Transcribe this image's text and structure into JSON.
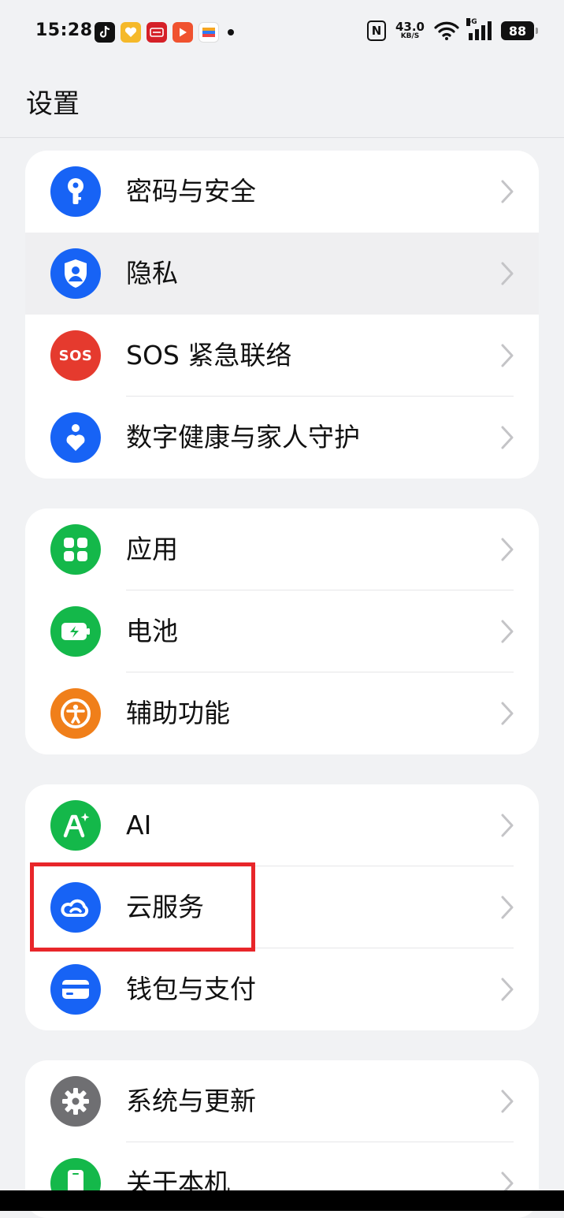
{
  "status": {
    "time": "15:28",
    "speed_value": "43.0",
    "speed_unit": "KB/S",
    "network": "5G",
    "battery": "88",
    "nfc": "N"
  },
  "notifications": [
    "tiktok-icon",
    "heart-app-icon",
    "news-app-icon",
    "video-app-icon",
    "wallet-app-icon"
  ],
  "page_title": "设置",
  "groups": [
    {
      "items": [
        {
          "label": "密码与安全",
          "icon": "key-icon",
          "color": "#1763f5"
        },
        {
          "label": "隐私",
          "icon": "shield-user-icon",
          "color": "#1763f5",
          "highlighted": true
        },
        {
          "label": "SOS 紧急联络",
          "icon": "sos-icon",
          "color": "#e53a2e",
          "icon_text": "SOS"
        },
        {
          "label": "数字健康与家人守护",
          "icon": "person-heart-icon",
          "color": "#1763f5"
        }
      ]
    },
    {
      "items": [
        {
          "label": "应用",
          "icon": "apps-grid-icon",
          "color": "#14b84a"
        },
        {
          "label": "电池",
          "icon": "battery-icon",
          "color": "#14b84a"
        },
        {
          "label": "辅助功能",
          "icon": "accessibility-icon",
          "color": "#f07f1a"
        }
      ]
    },
    {
      "items": [
        {
          "label": "AI",
          "icon": "ai-sparkle-icon",
          "color": "#14b84a"
        },
        {
          "label": "云服务",
          "icon": "cloud-icon",
          "color": "#1763f5",
          "annotated": true
        },
        {
          "label": "钱包与支付",
          "icon": "wallet-card-icon",
          "color": "#1763f5"
        }
      ]
    },
    {
      "items": [
        {
          "label": "系统与更新",
          "icon": "gear-icon",
          "color": "#6f6f72"
        },
        {
          "label": "关于本机",
          "icon": "phone-icon",
          "color": "#14b84a"
        }
      ]
    }
  ]
}
